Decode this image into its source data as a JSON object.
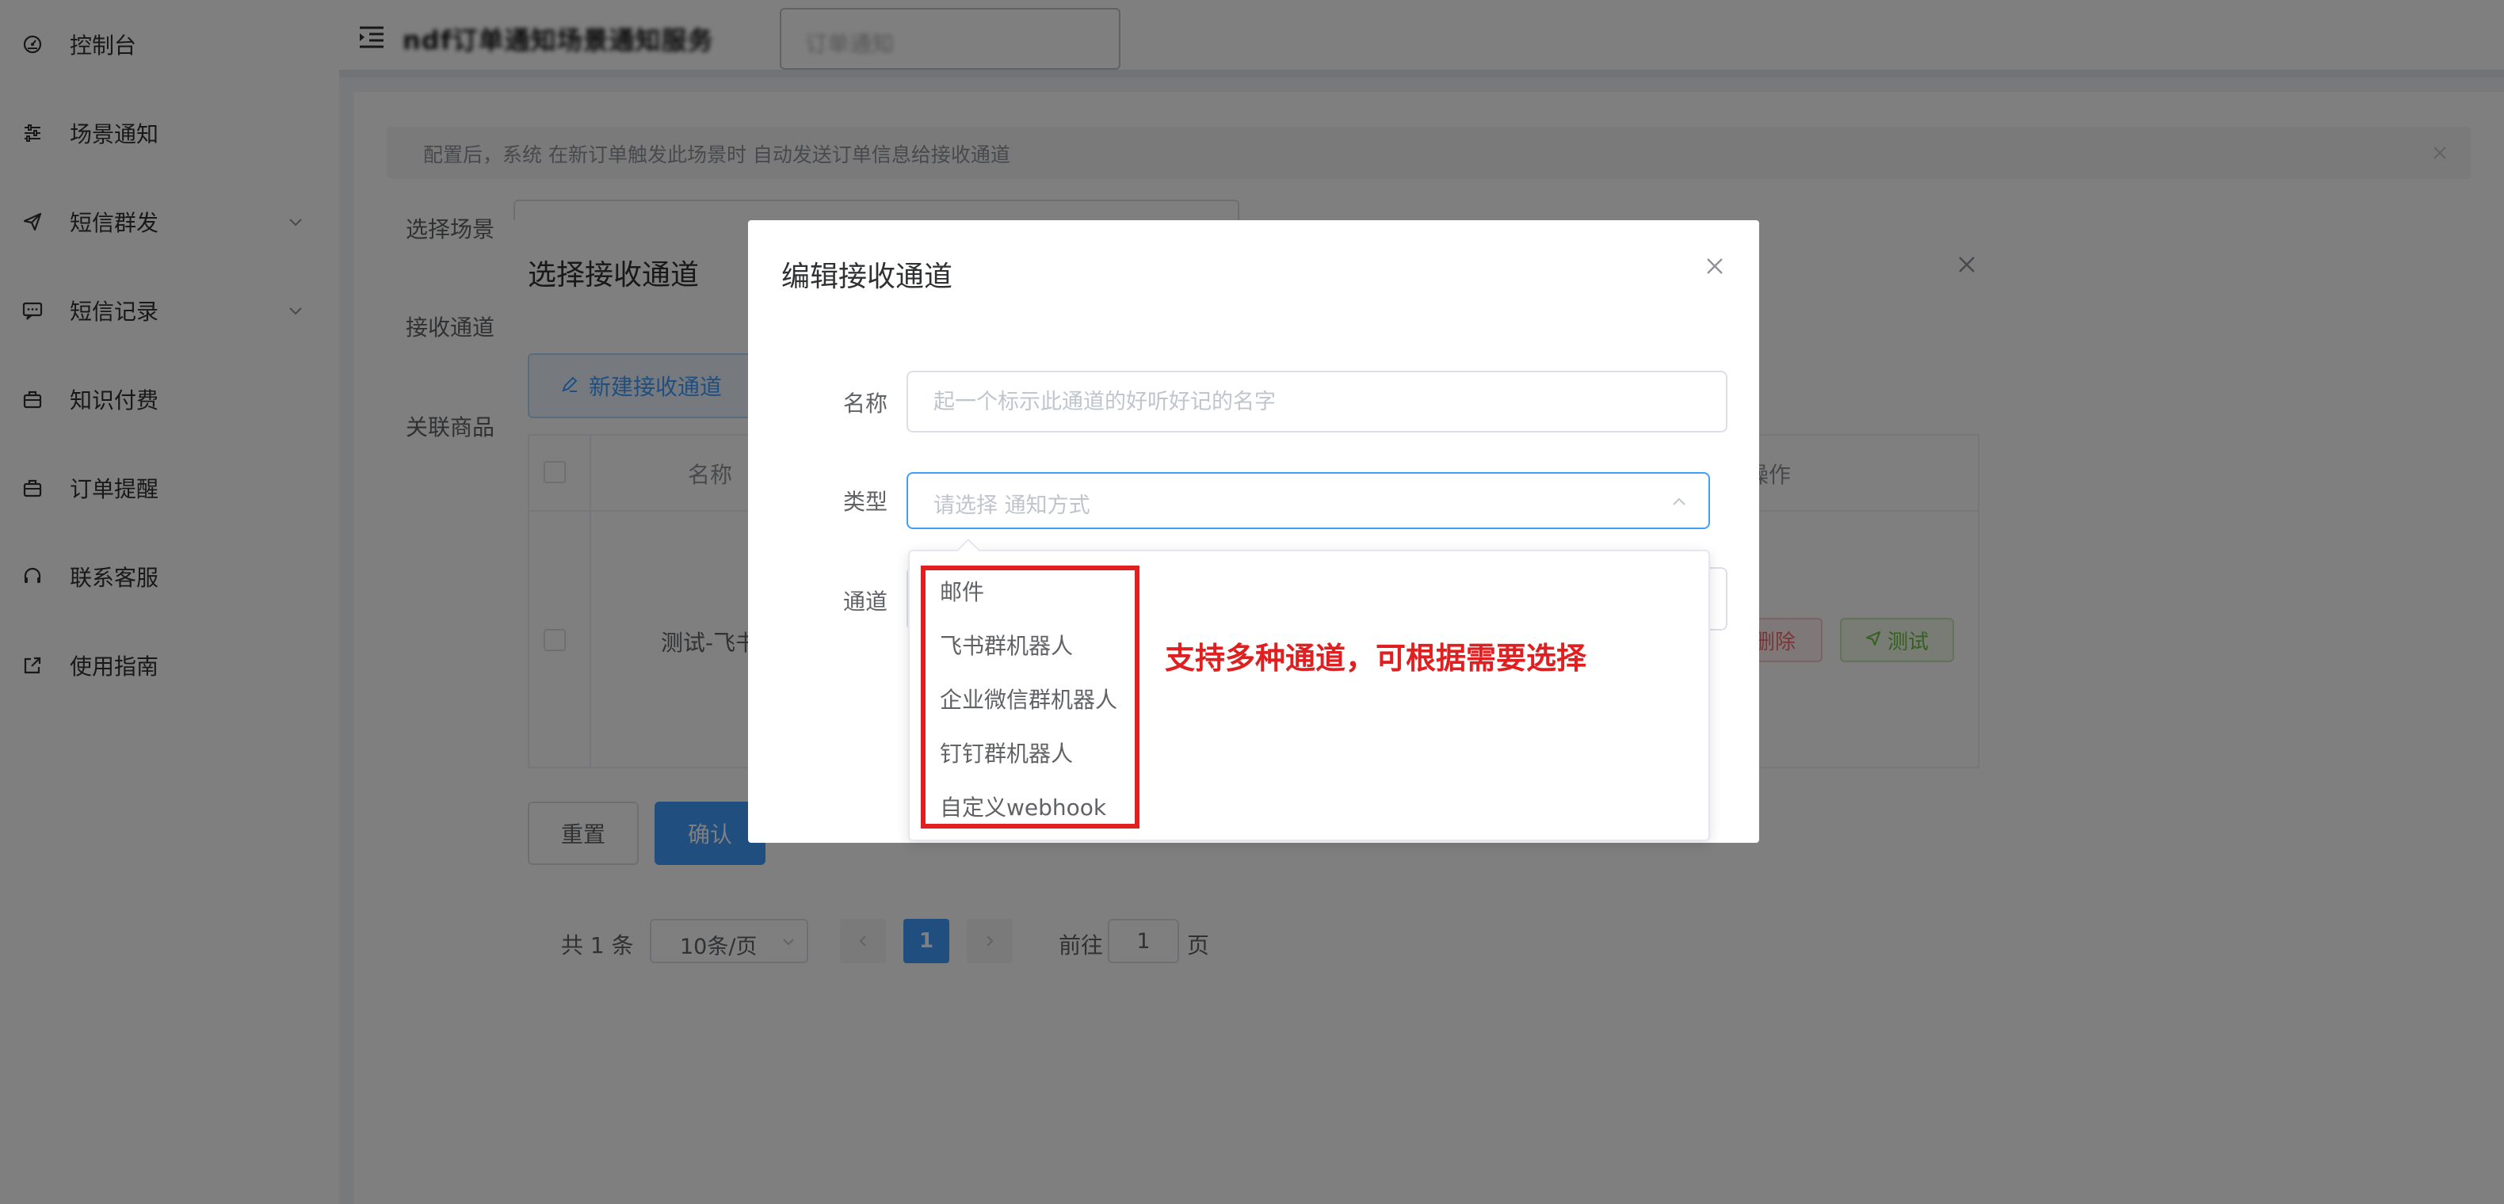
{
  "sidebar": {
    "items": [
      {
        "label": "控制台",
        "icon": "dashboard-icon"
      },
      {
        "label": "场景通知",
        "icon": "sliders-icon"
      },
      {
        "label": "短信群发",
        "icon": "send-icon",
        "has_chevron": true
      },
      {
        "label": "短信记录",
        "icon": "message-icon",
        "has_chevron": true
      },
      {
        "label": "知识付费",
        "icon": "briefcase-icon"
      },
      {
        "label": "订单提醒",
        "icon": "briefcase-icon"
      },
      {
        "label": "联系客服",
        "icon": "headset-icon"
      },
      {
        "label": "使用指南",
        "icon": "external-link-icon"
      }
    ]
  },
  "header": {
    "title": "ndf订单通知场景通知服务",
    "input_value": "订单通知"
  },
  "main": {
    "alert_text": "配置后，系统 在新订单触发此场景时 自动发送订单信息给接收通道",
    "labels": {
      "scene": "选择场景",
      "channel": "接收通道",
      "product": "关联商品"
    }
  },
  "select_dialog": {
    "title": "选择接收通道",
    "new_button": "新建接收通道",
    "columns": {
      "name": "名称",
      "ops": "操作"
    },
    "rows": [
      {
        "name": "测试-飞书",
        "delete": "删除",
        "test": "测试"
      }
    ],
    "reset": "重置",
    "confirm": "确认",
    "pagination": {
      "total": "共 1 条",
      "page_size": "10条/页",
      "current": "1",
      "goto_label": "前往",
      "goto_value": "1",
      "page_unit": "页"
    }
  },
  "edit_dialog": {
    "title": "编辑接收通道",
    "name_label": "名称",
    "name_placeholder": "起一个标示此通道的好听好记的名字",
    "type_label": "类型",
    "type_placeholder": "请选择 通知方式",
    "channel_label": "通道",
    "type_options": [
      "邮件",
      "飞书群机器人",
      "企业微信群机器人",
      "钉钉群机器人",
      "自定义webhook"
    ]
  },
  "annotation": {
    "text": "支持多种通道，可根据需要选择",
    "color": "#e02020"
  },
  "colors": {
    "primary": "#409eff",
    "danger": "#f56c6c",
    "success": "#67c23a",
    "annotation_red": "#e02020"
  }
}
